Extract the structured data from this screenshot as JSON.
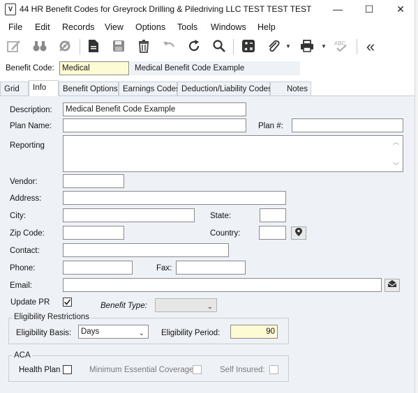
{
  "window": {
    "title": "44 HR Benefit Codes for Greyrock Drilling & Piledriving LLC TEST TEST TEST",
    "icon_glyph": "V",
    "minimize": "—",
    "maximize": "☐",
    "close": "✕"
  },
  "menu": [
    "File",
    "Edit",
    "Records",
    "View",
    "Options",
    "Tools",
    "Windows",
    "Help"
  ],
  "toolbar": {
    "icons": [
      "edit-icon",
      "binoculars-icon",
      "settings-icon",
      "new-document-icon",
      "save-icon",
      "delete-icon",
      "undo-icon",
      "refresh-icon",
      "search-icon",
      "calculator-icon",
      "attachment-icon",
      "print-icon",
      "spellcheck-icon",
      "collapse-icon"
    ],
    "collapse": "«"
  },
  "header": {
    "benefit_code_label": "Benefit Code:",
    "benefit_code_value": "Medical",
    "benefit_code_desc": "Medical Benefit Code Example"
  },
  "tabs": [
    "Grid",
    "Info",
    "Benefit Options",
    "Earnings Codes",
    "Deduction/Liability Codes",
    "Notes"
  ],
  "active_tab": "Info",
  "form": {
    "description_label": "Description:",
    "description_value": "Medical Benefit Code Example",
    "plan_name_label": "Plan Name:",
    "plan_name_value": "",
    "plan_num_label": "Plan #:",
    "plan_num_value": "",
    "reporting_label": "Reporting",
    "reporting_value": "",
    "vendor_label": "Vendor:",
    "address_label": "Address:",
    "city_label": "City:",
    "state_label": "State:",
    "zip_label": "Zip Code:",
    "country_label": "Country:",
    "contact_label": "Contact:",
    "phone_label": "Phone:",
    "fax_label": "Fax:",
    "email_label": "Email:",
    "update_pr_label": "Update PR",
    "update_pr_checked": true,
    "benefit_type_label": "Benefit Type:",
    "benefit_type_value": ""
  },
  "eligibility": {
    "group_title": "Eligibility Restrictions",
    "basis_label": "Eligibility Basis:",
    "basis_value": "Days",
    "period_label": "Eligibility Period:",
    "period_value": "90"
  },
  "aca": {
    "group_title": "ACA",
    "health_plan_label": "Health Plan",
    "mec_label": "Minimum Essential Coverage:",
    "self_insured_label": "Self Insured:"
  }
}
